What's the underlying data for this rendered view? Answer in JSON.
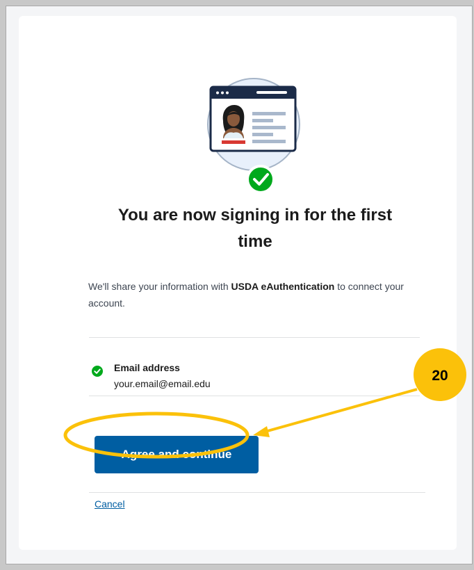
{
  "heading": "You are now signing in for the first time",
  "intro": {
    "prefix": "We'll share your information with ",
    "service": "USDA eAuthentication",
    "suffix": " to connect your account."
  },
  "shared_item": {
    "title": "Email address",
    "value": "your.email@email.edu"
  },
  "buttons": {
    "agree": "Agree and continue",
    "cancel": "Cancel"
  },
  "annotation": {
    "step": "20"
  },
  "colors": {
    "primary": "#005ea2",
    "success": "#00a91c",
    "callout": "#fbc10a",
    "text": "#1b1b1b"
  },
  "icons": {
    "hero": "identity-card-illustration",
    "check": "check-circle-icon"
  }
}
